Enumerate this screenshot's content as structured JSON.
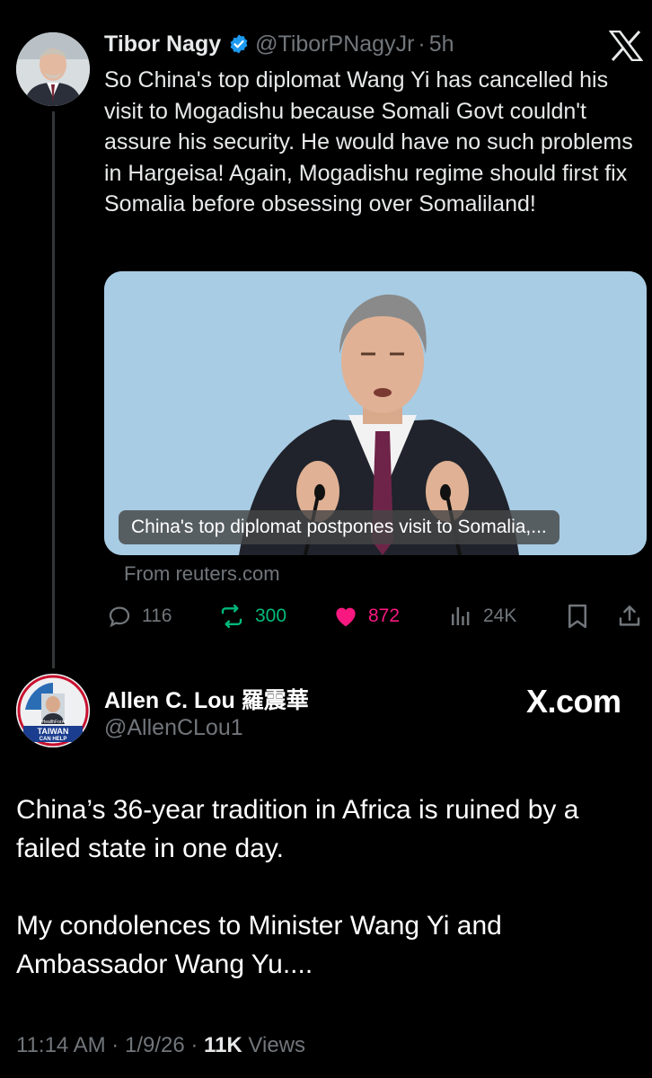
{
  "tweet1": {
    "display_name": "Tibor Nagy",
    "handle": "@TiborPNagyJr",
    "separator": "·",
    "time": "5h",
    "text": "So China's top diplomat Wang Yi has cancelled his visit to Mogadishu because Somali Govt couldn't assure his security. He would have no such problems in Hargeisa! Again, Mogadishu regime should first fix Somalia before obsessing over Somaliland!",
    "link_card": {
      "caption": "China's top diplomat postpones visit to Somalia,...",
      "source": "From reuters.com"
    },
    "actions": {
      "replies": "116",
      "reposts": "300",
      "likes": "872",
      "views": "24K"
    }
  },
  "tweet2": {
    "display_name": "Allen C. Lou 羅震華",
    "handle": "@AllenCLou1",
    "avatar_text": [
      "#HealthForAll",
      "TAIWAN",
      "CAN HELP"
    ],
    "paragraphs": [
      "China’s 36-year tradition in Africa is ruined by a failed state in one day.",
      "My condolences to Minister Wang Yi and Ambassador Wang Yu...."
    ],
    "meta": {
      "time": "11:14 AM",
      "sep1": "·",
      "date": "1/9/26",
      "sep2": "·",
      "views_count": "11K",
      "views_label": "Views"
    }
  },
  "watermark": "X.com",
  "colors": {
    "background": "#000000",
    "verified": "#1d9bf0",
    "repost": "#00ba7c",
    "like": "#f91880",
    "secondary_text": "#71767b"
  },
  "icons": [
    "verified-badge-icon",
    "x-logo-icon",
    "reply-icon",
    "repost-icon",
    "heart-icon",
    "views-icon",
    "bookmark-icon",
    "share-icon"
  ]
}
